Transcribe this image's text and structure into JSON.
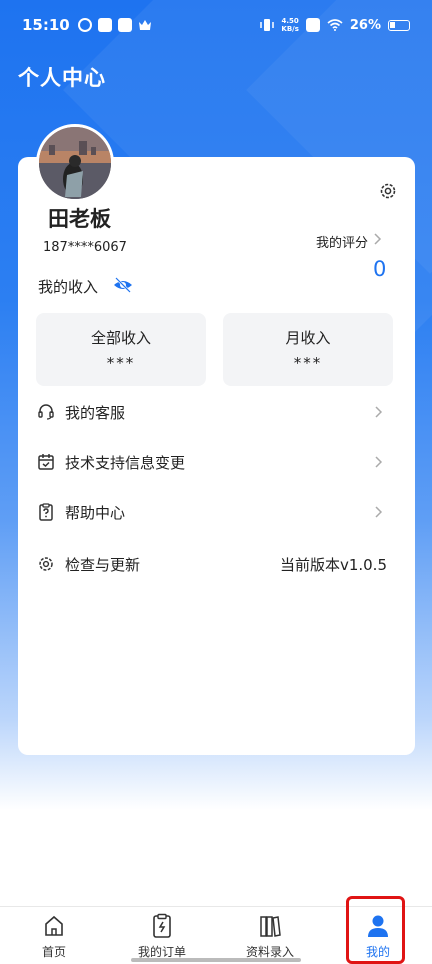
{
  "status_bar": {
    "time": "15:10",
    "net_speed_value": "4.50",
    "net_speed_unit": "KB/s",
    "battery": "26%"
  },
  "header": {
    "title": "个人中心"
  },
  "profile": {
    "name": "田老板",
    "phone": "187****6067"
  },
  "rating": {
    "label": "我的评分",
    "value": "0"
  },
  "income": {
    "label": "我的收入",
    "boxes": [
      {
        "label": "全部收入",
        "value": "***"
      },
      {
        "label": "月收入",
        "value": "***"
      }
    ]
  },
  "menu": [
    {
      "label": "我的客服",
      "icon": "headset-icon"
    },
    {
      "label": "技术支持信息变更",
      "icon": "calendar-check-icon"
    },
    {
      "label": "帮助中心",
      "icon": "help-clipboard-icon"
    },
    {
      "label": "检查与更新",
      "icon": "gear-icon",
      "value": "当前版本v1.0.5"
    }
  ],
  "bottom_nav": [
    {
      "label": "首页",
      "icon": "home-icon"
    },
    {
      "label": "我的订单",
      "icon": "order-clipboard-icon"
    },
    {
      "label": "资料录入",
      "icon": "books-icon"
    },
    {
      "label": "我的",
      "icon": "user-icon",
      "active": true
    }
  ],
  "colors": {
    "primary": "#1e73f0",
    "highlight": "#e01414"
  }
}
